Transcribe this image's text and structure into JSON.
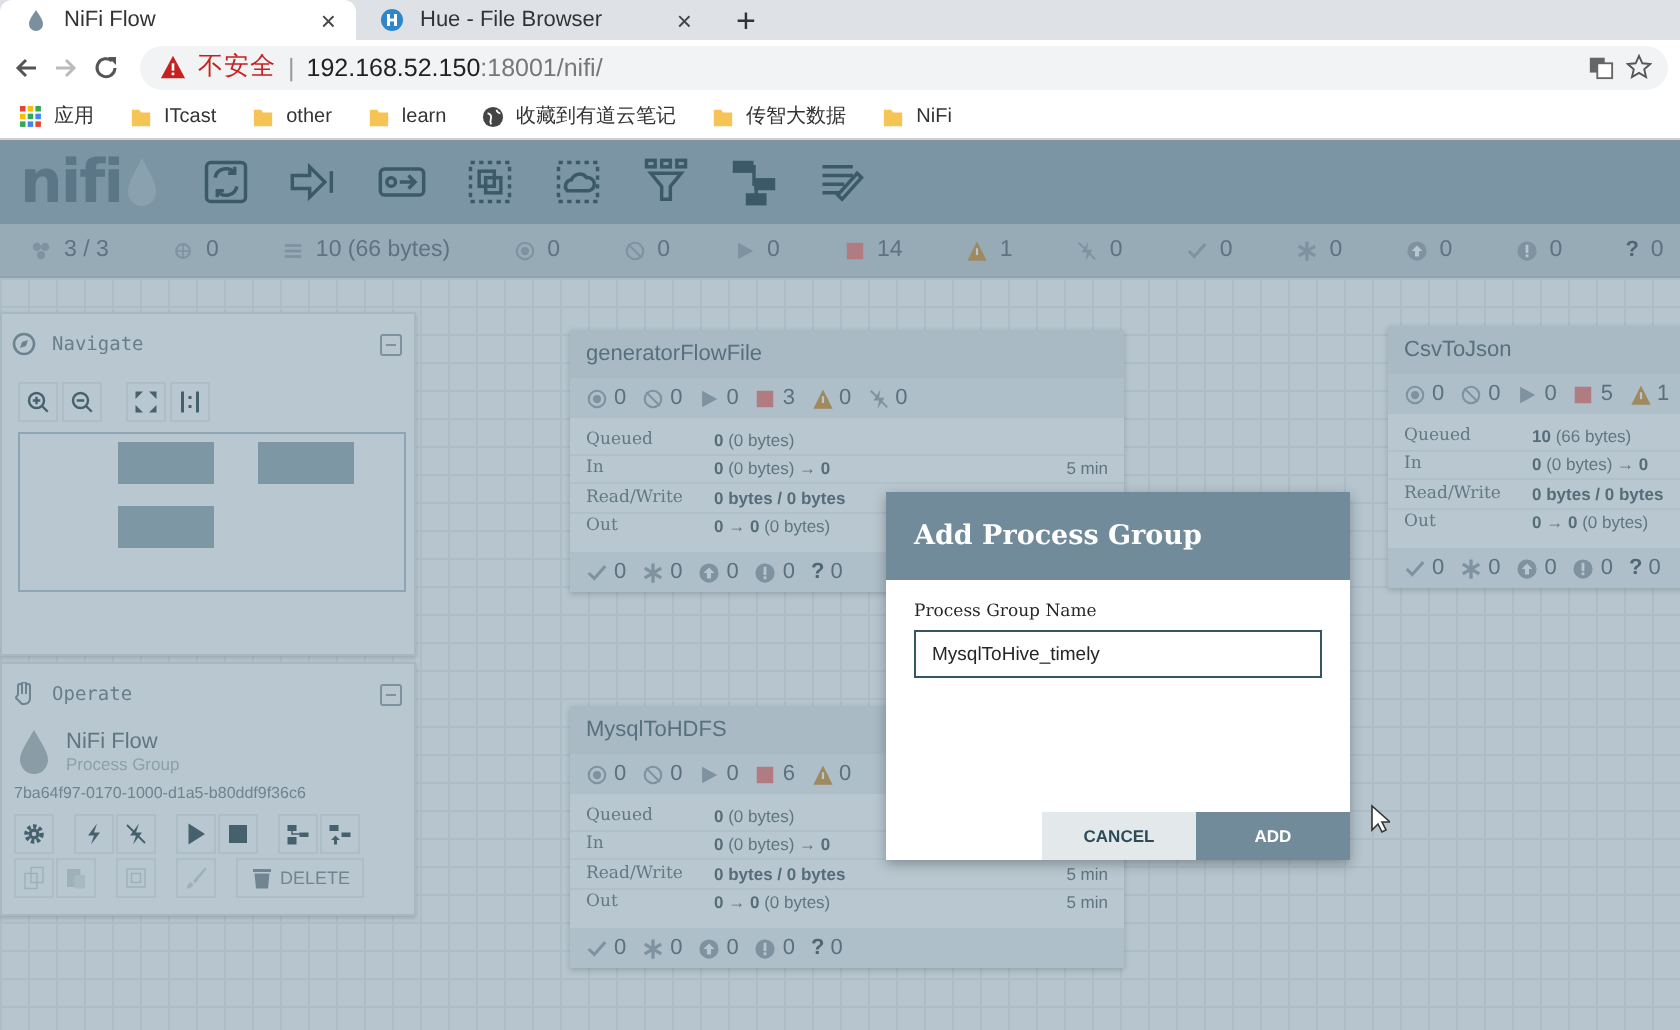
{
  "browser": {
    "tabs": [
      {
        "title": "NiFi Flow",
        "selected": true,
        "close": "×",
        "kind": "nifi"
      },
      {
        "title": "Hue - File Browser",
        "selected": false,
        "close": "×",
        "kind": "hue"
      }
    ],
    "new_tab": "+",
    "address": {
      "security": "不安全",
      "separator": "|",
      "host": "192.168.52.150",
      "path": ":18001/nifi/"
    },
    "bookmarks": [
      {
        "kind": "apps",
        "label": "应用"
      },
      {
        "kind": "folder",
        "label": "ITcast"
      },
      {
        "kind": "folder",
        "label": "other"
      },
      {
        "kind": "folder",
        "label": "learn"
      },
      {
        "kind": "globe",
        "label": "收藏到有道云笔记"
      },
      {
        "kind": "folder",
        "label": "传智大数据"
      },
      {
        "kind": "folder",
        "label": "NiFi"
      }
    ]
  },
  "header": {
    "logo": "nifi",
    "tools": [
      {
        "kind": "processor"
      },
      {
        "kind": "input-port"
      },
      {
        "kind": "output-port"
      },
      {
        "kind": "process-group"
      },
      {
        "kind": "remote-process-group"
      },
      {
        "kind": "funnel"
      },
      {
        "kind": "template"
      },
      {
        "kind": "label"
      }
    ]
  },
  "status_bar": [
    {
      "kind": "cluster",
      "value": "3 / 3"
    },
    {
      "kind": "connected",
      "value": "0"
    },
    {
      "kind": "queue",
      "value": "10 (66 bytes)"
    },
    {
      "kind": "transmitting",
      "value": "0"
    },
    {
      "kind": "not-transmitting",
      "value": "0"
    },
    {
      "kind": "running",
      "value": "0"
    },
    {
      "kind": "stopped",
      "value": "14"
    },
    {
      "kind": "invalid",
      "value": "1"
    },
    {
      "kind": "disabled",
      "value": "0"
    },
    {
      "kind": "up-to-date",
      "value": "0"
    },
    {
      "kind": "locally-modified",
      "value": "0"
    },
    {
      "kind": "stale",
      "value": "0"
    },
    {
      "kind": "sync-failure",
      "value": "0"
    },
    {
      "kind": "unknown",
      "glyph": "?",
      "value": "0"
    }
  ],
  "navigate": {
    "title": "Navigate",
    "tools": [
      {
        "kind": "zoom-in"
      },
      {
        "kind": "zoom-out"
      },
      {
        "kind": "fit"
      },
      {
        "kind": "actual-size"
      }
    ]
  },
  "operate": {
    "title": "Operate",
    "name": "NiFi Flow",
    "type": "Process Group",
    "id": "7ba64f97-0170-1000-d1a5-b80ddf9f36c6",
    "actions": [
      {
        "kind": "configure",
        "disabled": false
      },
      {
        "kind": "enable",
        "disabled": false
      },
      {
        "kind": "disable",
        "disabled": false
      },
      {
        "kind": "start",
        "disabled": false
      },
      {
        "kind": "stop",
        "disabled": false
      },
      {
        "kind": "create-template",
        "disabled": false
      },
      {
        "kind": "upload-template",
        "disabled": false
      },
      {
        "kind": "copy",
        "disabled": true
      },
      {
        "kind": "paste",
        "disabled": true
      },
      {
        "kind": "group",
        "disabled": true
      },
      {
        "kind": "color",
        "disabled": true
      }
    ],
    "delete": {
      "label": "DELETE",
      "disabled": true
    }
  },
  "groups": [
    {
      "name": "generatorFlowFile",
      "stats": [
        {
          "kind": "transmitting",
          "value": "0"
        },
        {
          "kind": "not-transmitting",
          "value": "0"
        },
        {
          "kind": "running",
          "value": "0"
        },
        {
          "kind": "stopped",
          "value": "3"
        },
        {
          "kind": "invalid",
          "value": "0"
        },
        {
          "kind": "disabled",
          "value": "0"
        }
      ],
      "rows": [
        {
          "label": "Queued",
          "value": "**0** (0 bytes)"
        },
        {
          "label": "In",
          "value": "**0** (0 bytes) → **0**",
          "time": "5 min"
        },
        {
          "label": "Read/Write",
          "value": "0 bytes / 0 bytes",
          "bold": true
        },
        {
          "label": "Out",
          "value": "**0** → **0** (0 bytes)"
        }
      ],
      "versions": [
        {
          "kind": "up-to-date",
          "value": "0"
        },
        {
          "kind": "locally-modified",
          "value": "0"
        },
        {
          "kind": "stale",
          "value": "0"
        },
        {
          "kind": "sync-failure",
          "value": "0"
        },
        {
          "kind": "unknown",
          "glyph": "?",
          "value": "0"
        }
      ]
    },
    {
      "name": "MysqlToHDFS",
      "stats": [
        {
          "kind": "transmitting",
          "value": "0"
        },
        {
          "kind": "not-transmitting",
          "value": "0"
        },
        {
          "kind": "running",
          "value": "0"
        },
        {
          "kind": "stopped",
          "value": "6"
        },
        {
          "kind": "invalid",
          "value": "0"
        }
      ],
      "rows": [
        {
          "label": "Queued",
          "value": "**0** (0 bytes)"
        },
        {
          "label": "In",
          "value": "**0** (0 bytes) → **0**"
        },
        {
          "label": "Read/Write",
          "value": "0 bytes / 0 bytes",
          "bold": true,
          "time": "5 min"
        },
        {
          "label": "Out",
          "value": "**0** → **0** (0 bytes)",
          "time": "5 min"
        }
      ],
      "versions": [
        {
          "kind": "up-to-date",
          "value": "0"
        },
        {
          "kind": "locally-modified",
          "value": "0"
        },
        {
          "kind": "stale",
          "value": "0"
        },
        {
          "kind": "sync-failure",
          "value": "0"
        },
        {
          "kind": "unknown",
          "glyph": "?",
          "value": "0"
        }
      ]
    },
    {
      "name": "CsvToJson",
      "stats": [
        {
          "kind": "transmitting",
          "value": "0"
        },
        {
          "kind": "not-transmitting",
          "value": "0"
        },
        {
          "kind": "running",
          "value": "0"
        },
        {
          "kind": "stopped",
          "value": "5"
        },
        {
          "kind": "invalid",
          "value": "1"
        }
      ],
      "rows": [
        {
          "label": "Queued",
          "value": "**10** (66 bytes)"
        },
        {
          "label": "In",
          "value": "**0** (0 bytes) → **0**"
        },
        {
          "label": "Read/Write",
          "value": "0 bytes / 0 bytes",
          "bold": true
        },
        {
          "label": "Out",
          "value": "**0** → **0** (0 bytes)"
        }
      ],
      "versions": [
        {
          "kind": "up-to-date",
          "value": "0"
        },
        {
          "kind": "locally-modified",
          "value": "0"
        },
        {
          "kind": "stale",
          "value": "0"
        },
        {
          "kind": "sync-failure",
          "value": "0"
        },
        {
          "kind": "unknown",
          "glyph": "?",
          "value": "0"
        }
      ]
    }
  ],
  "dialog": {
    "title": "Add Process Group",
    "field_label": "Process Group Name",
    "value": "MysqlToHive_timely",
    "buttons": [
      {
        "label": "CANCEL",
        "kind": "secondary"
      },
      {
        "label": "ADD",
        "kind": "primary"
      }
    ]
  }
}
